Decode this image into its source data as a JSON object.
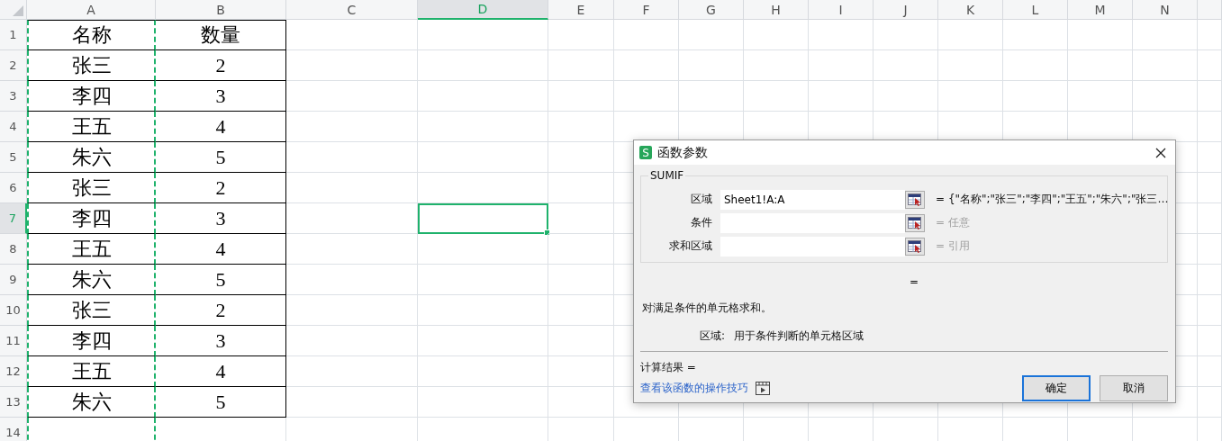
{
  "sheet": {
    "columns": [
      {
        "label": "A",
        "selected": false,
        "copied": true
      },
      {
        "label": "B",
        "selected": false,
        "copied": false
      },
      {
        "label": "C",
        "selected": false,
        "copied": false
      },
      {
        "label": "D",
        "selected": true,
        "copied": false
      },
      {
        "label": "E",
        "selected": false,
        "copied": false
      },
      {
        "label": "F",
        "selected": false,
        "copied": false
      },
      {
        "label": "G",
        "selected": false,
        "copied": false
      },
      {
        "label": "H",
        "selected": false,
        "copied": false
      },
      {
        "label": "I",
        "selected": false,
        "copied": false
      },
      {
        "label": "J",
        "selected": false,
        "copied": false
      },
      {
        "label": "K",
        "selected": false,
        "copied": false
      },
      {
        "label": "L",
        "selected": false,
        "copied": false
      },
      {
        "label": "M",
        "selected": false,
        "copied": false
      },
      {
        "label": "N",
        "selected": false,
        "copied": false
      }
    ],
    "rows": [
      {
        "label": "1",
        "selected": false,
        "cells": [
          "名称",
          "数量"
        ]
      },
      {
        "label": "2",
        "selected": false,
        "cells": [
          "张三",
          "2"
        ]
      },
      {
        "label": "3",
        "selected": false,
        "cells": [
          "李四",
          "3"
        ]
      },
      {
        "label": "4",
        "selected": false,
        "cells": [
          "王五",
          "4"
        ]
      },
      {
        "label": "5",
        "selected": false,
        "cells": [
          "朱六",
          "5"
        ]
      },
      {
        "label": "6",
        "selected": false,
        "cells": [
          "张三",
          "2"
        ]
      },
      {
        "label": "7",
        "selected": true,
        "cells": [
          "李四",
          "3"
        ]
      },
      {
        "label": "8",
        "selected": false,
        "cells": [
          "王五",
          "4"
        ]
      },
      {
        "label": "9",
        "selected": false,
        "cells": [
          "朱六",
          "5"
        ]
      },
      {
        "label": "10",
        "selected": false,
        "cells": [
          "张三",
          "2"
        ]
      },
      {
        "label": "11",
        "selected": false,
        "cells": [
          "李四",
          "3"
        ]
      },
      {
        "label": "12",
        "selected": false,
        "cells": [
          "王五",
          "4"
        ]
      },
      {
        "label": "13",
        "selected": false,
        "cells": [
          "朱六",
          "5"
        ]
      },
      {
        "label": "14",
        "selected": false,
        "cells": []
      }
    ]
  },
  "dialog": {
    "icon_letter": "S",
    "title": "函数参数",
    "function_name": "SUMIF",
    "arguments": [
      {
        "label": "区域",
        "value": "Sheet1!A:A",
        "equals": "=",
        "result": "{\"名称\";\"张三\";\"李四\";\"王五\";\"朱六\";\"张三…",
        "hint": false
      },
      {
        "label": "条件",
        "equals": "=",
        "result": "任意",
        "hint": true
      },
      {
        "label": "求和区域",
        "equals": "=",
        "result": "引用",
        "hint": true
      }
    ],
    "formula_result": "=",
    "description": "对满足条件的单元格求和。",
    "argument_help": {
      "label": "区域:",
      "text": "用于条件判断的单元格区域"
    },
    "calc_result": "计算结果 =",
    "help_link": "查看该函数的操作技巧",
    "buttons": [
      {
        "label": "确定",
        "default": true
      },
      {
        "label": "取消",
        "default": false
      }
    ]
  }
}
